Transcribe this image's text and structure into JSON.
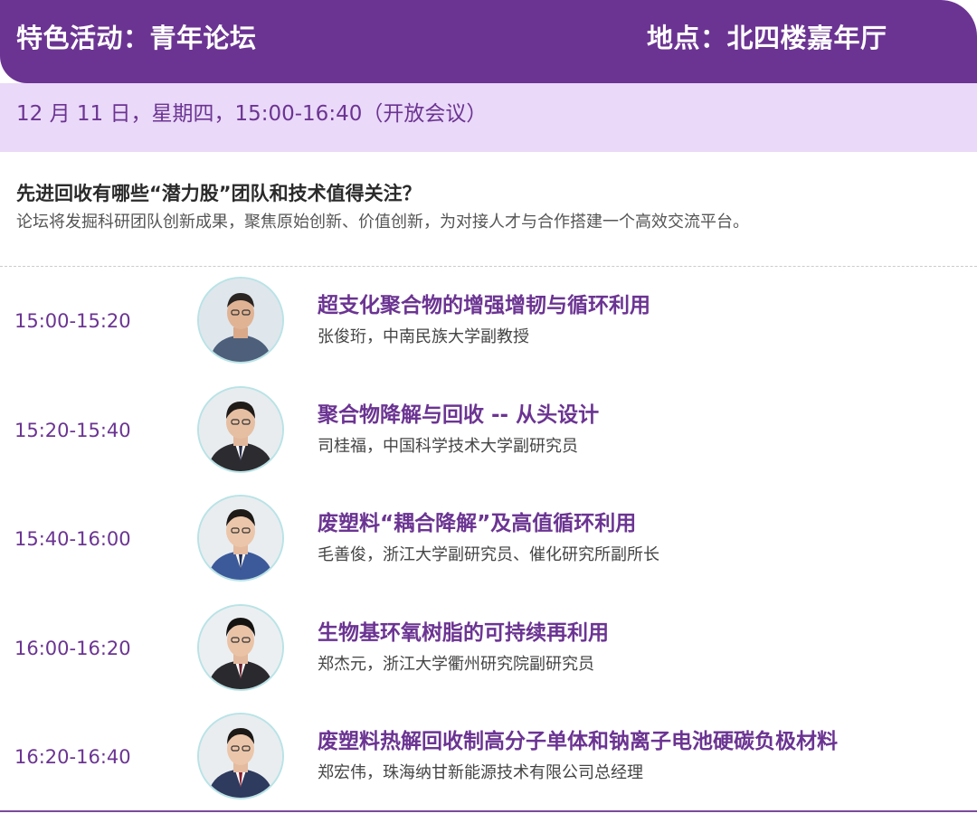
{
  "header": {
    "title": "特色活动：青年论坛",
    "location": "地点：北四楼嘉年厅"
  },
  "date_bar": {
    "text": "12 月 11 日，星期四，15:00-16:40（开放会议）"
  },
  "intro": {
    "question": "先进回收有哪些“潜力股”团队和技术值得关注？",
    "description": "论坛将发掘科研团队创新成果，聚焦原始创新、价值创新，为对接人才与合作搭建一个高效交流平台。"
  },
  "colors": {
    "primary": "#6b3492",
    "light_bar": "#ead9f8",
    "avatar_border": "#b9e3e6"
  },
  "agenda": [
    {
      "time": "15:00-15:20",
      "title": "超支化聚合物的增强增韧与循环利用",
      "speaker": "张俊珩，中南民族大学副教授",
      "avatar_icon": "speaker-photo"
    },
    {
      "time": "15:20-15:40",
      "title": "聚合物降解与回收 -- 从头设计",
      "speaker": "司桂福，中国科学技术大学副研究员",
      "avatar_icon": "speaker-photo"
    },
    {
      "time": "15:40-16:00",
      "title": "废塑料“耦合降解”及高值循环利用",
      "speaker": "毛善俊，浙江大学副研究员、催化研究所副所长",
      "avatar_icon": "speaker-photo"
    },
    {
      "time": "16:00-16:20",
      "title": "生物基环氧树脂的可持续再利用",
      "speaker": "郑杰元，浙江大学衢州研究院副研究员",
      "avatar_icon": "speaker-photo"
    },
    {
      "time": "16:20-16:40",
      "title": "废塑料热解回收制高分子单体和钠离子电池硬碳负极材料",
      "speaker": "郑宏伟，珠海纳甘新能源技术有限公司总经理",
      "avatar_icon": "speaker-photo"
    }
  ]
}
